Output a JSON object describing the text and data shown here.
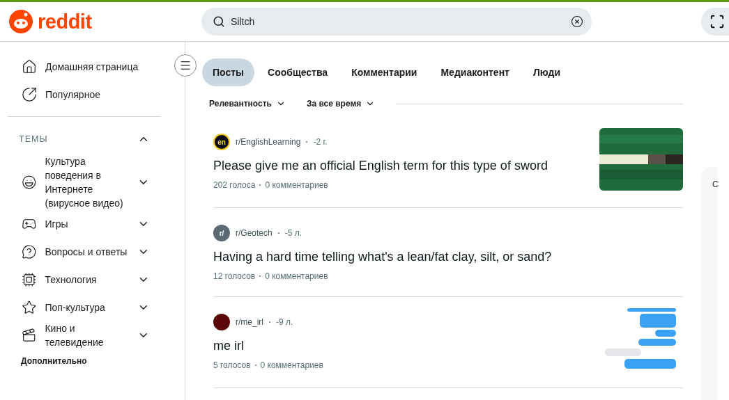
{
  "header": {
    "logo": "reddit",
    "search": {
      "value": "Siltch"
    }
  },
  "sidebar": {
    "items": [
      {
        "label": "Домашняя страница"
      },
      {
        "label": "Популярное"
      }
    ],
    "topics": {
      "title": "ТЕМЫ",
      "expanded": true,
      "items": [
        {
          "label": "Культура поведения в Интернете (вирусное видео)",
          "expanded": false
        },
        {
          "label": "Игры",
          "expanded": false
        },
        {
          "label": "Вопросы и ответы",
          "expanded": false
        },
        {
          "label": "Технология",
          "expanded": false
        },
        {
          "label": "Поп-культура",
          "expanded": false
        },
        {
          "label": "Кино и телевидение",
          "expanded": false
        }
      ]
    },
    "more": "Дополнительно"
  },
  "tabs": [
    {
      "label": "Посты",
      "selected": true
    },
    {
      "label": "Сообщества",
      "selected": false
    },
    {
      "label": "Комментарии",
      "selected": false
    },
    {
      "label": "Медиаконтент",
      "selected": false
    },
    {
      "label": "Люди",
      "selected": false
    }
  ],
  "filters": [
    "Релевантность",
    "За все время"
  ],
  "posts": [
    {
      "avatar": {
        "kind": "en",
        "text": "en"
      },
      "community": "r/EnglishLearning",
      "age": "-2 г.",
      "title": "Please give me an official English term for this type of sword",
      "votes": "202 голоса",
      "comments": "0 комментариев"
    },
    {
      "avatar": {
        "kind": "r",
        "text": "r/"
      },
      "community": "r/Geotech",
      "age": "-5 л.",
      "title": "Having a hard time telling what's a lean/fat clay, silt, or sand?",
      "votes": "12 голосов",
      "comments": "0 комментариев"
    },
    {
      "avatar": {
        "kind": "dark"
      },
      "community": "r/me_irl",
      "age": "-9 л.",
      "title": "me irl",
      "votes": "5 голосов",
      "comments": "0 комментариев"
    }
  ],
  "side_panel": {
    "title": "С"
  }
}
